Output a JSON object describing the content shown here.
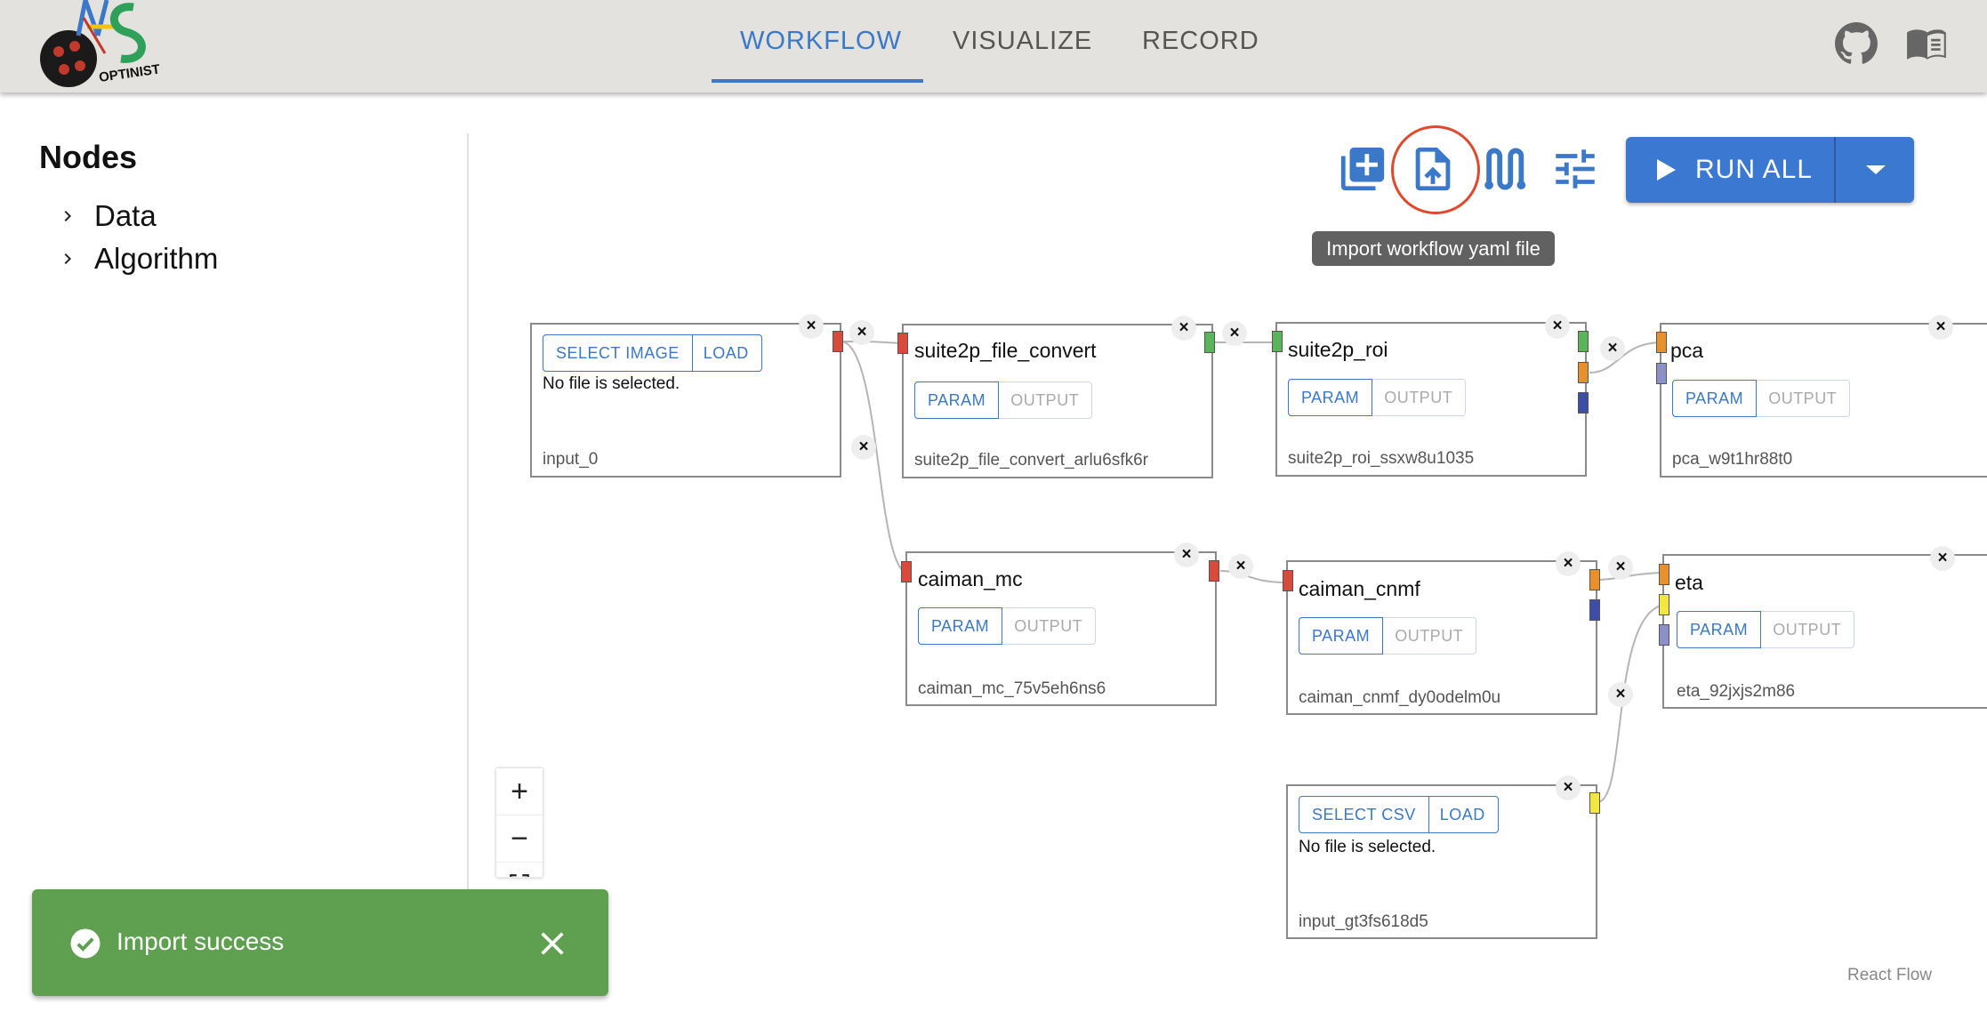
{
  "header": {
    "logo_text": "OPTINIST",
    "tabs": [
      {
        "label": "WORKFLOW",
        "active": true
      },
      {
        "label": "VISUALIZE",
        "active": false
      },
      {
        "label": "RECORD",
        "active": false
      }
    ],
    "icons": [
      "github-icon",
      "book-icon"
    ],
    "accent_color": "#3b78c8"
  },
  "sidebar": {
    "title": "Nodes",
    "items": [
      {
        "label": "Data"
      },
      {
        "label": "Algorithm"
      }
    ]
  },
  "toolbar": {
    "tools": [
      "add-workflow-icon",
      "import-yaml-icon",
      "path-icon",
      "settings-tune-icon"
    ],
    "tooltip": "Import workflow yaml file",
    "run_all_label": "RUN ALL"
  },
  "nodes": {
    "input_0": {
      "buttons": [
        "SELECT IMAGE",
        "LOAD"
      ],
      "status": "No file is selected.",
      "id": "input_0"
    },
    "suite2p_file_convert": {
      "title": "suite2p_file_convert",
      "param": "PARAM",
      "output": "OUTPUT",
      "id": "suite2p_file_convert_arlu6sfk6r"
    },
    "suite2p_roi": {
      "title": "suite2p_roi",
      "param": "PARAM",
      "output": "OUTPUT",
      "id": "suite2p_roi_ssxw8u1035"
    },
    "pca": {
      "title": "pca",
      "param": "PARAM",
      "output": "OUTPUT",
      "id": "pca_w9t1hr88t0"
    },
    "caiman_mc": {
      "title": "caiman_mc",
      "param": "PARAM",
      "output": "OUTPUT",
      "id": "caiman_mc_75v5eh6ns6"
    },
    "caiman_cnmf": {
      "title": "caiman_cnmf",
      "param": "PARAM",
      "output": "OUTPUT",
      "id": "caiman_cnmf_dy0odelm0u"
    },
    "eta": {
      "title": "eta",
      "param": "PARAM",
      "output": "OUTPUT",
      "id": "eta_92jxjs2m86"
    },
    "input_csv": {
      "buttons": [
        "SELECT CSV",
        "LOAD"
      ],
      "status": "No file is selected.",
      "id": "input_gt3fs618d5"
    }
  },
  "close_symbol": "×",
  "zoom_controls": {
    "zoom_in": "+",
    "zoom_out": "−"
  },
  "attribution": "React Flow",
  "snackbar": {
    "message": "Import success",
    "color": "#5ea04f"
  }
}
